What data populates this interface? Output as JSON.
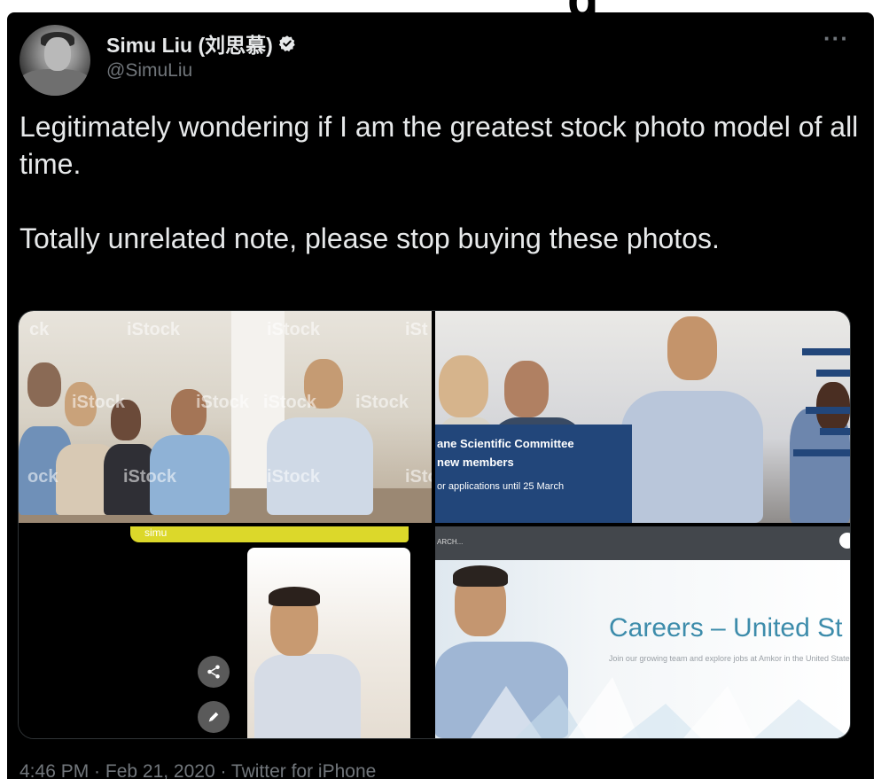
{
  "tweet": {
    "author_name": "Simu Liu (刘思慕)",
    "handle": "@SimuLiu",
    "more_icon": "more-dots-icon",
    "verified_icon": "verified-badge-icon",
    "paragraph_1": "Legitimately wondering if I am the greatest stock photo model of all time.",
    "paragraph_2": "Totally unrelated note, please stop buying these photos.",
    "meta": "4:46 PM · Feb 21, 2020 · Twitter for iPhone"
  },
  "media": {
    "top_left": {
      "watermarks": [
        "ck",
        "iStock",
        "iStock",
        "iSt",
        "iStock",
        "iStock",
        "iStock",
        "iStock",
        "ock",
        "iStock",
        "iStock",
        "iSto"
      ]
    },
    "top_right": {
      "banner_line_1": "ane Scientific Committee",
      "banner_line_2": "new members",
      "banner_line_3": "or applications until 25 March"
    },
    "bottom_left": {
      "yellow_label": "simu",
      "share_icon": "share-icon",
      "edit_icon": "pencil-icon"
    },
    "bottom_right": {
      "search_label": "ARCH...",
      "careers_title": "Careers – United St",
      "careers_sub": "Join our growing team and explore jobs at Amkor in the United States"
    }
  },
  "colors": {
    "background": "#000000",
    "text_primary": "#e7e9ea",
    "text_secondary": "#71767b",
    "banner_blue": "#22467a",
    "yellow": "#dcd82a",
    "careers_blue": "#3d8cab"
  }
}
